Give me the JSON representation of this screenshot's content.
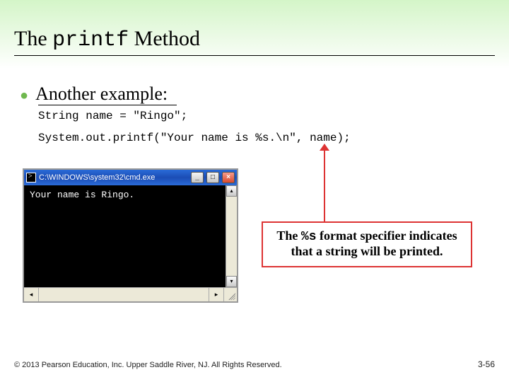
{
  "title": {
    "pre": "The ",
    "mono": "printf",
    "post": " Method"
  },
  "bullet": "Another example:",
  "code": {
    "line1": "String name = \"Ringo\";",
    "line2": "System.out.printf(\"Your name is %s.\\n\", name);"
  },
  "terminal": {
    "title": "C:\\WINDOWS\\system32\\cmd.exe",
    "output": "Your name is Ringo.",
    "btn_min": "_",
    "btn_max": "□",
    "btn_close": "×",
    "scroll_up": "▴",
    "scroll_down": "▾",
    "scroll_left": "◂",
    "scroll_right": "▸"
  },
  "callout": {
    "pre": "The ",
    "mono": "%s",
    "post": " format specifier indicates that a string will be printed."
  },
  "footer": "© 2013 Pearson Education, Inc. Upper Saddle River, NJ. All Rights Reserved.",
  "pagenum": "3-56"
}
